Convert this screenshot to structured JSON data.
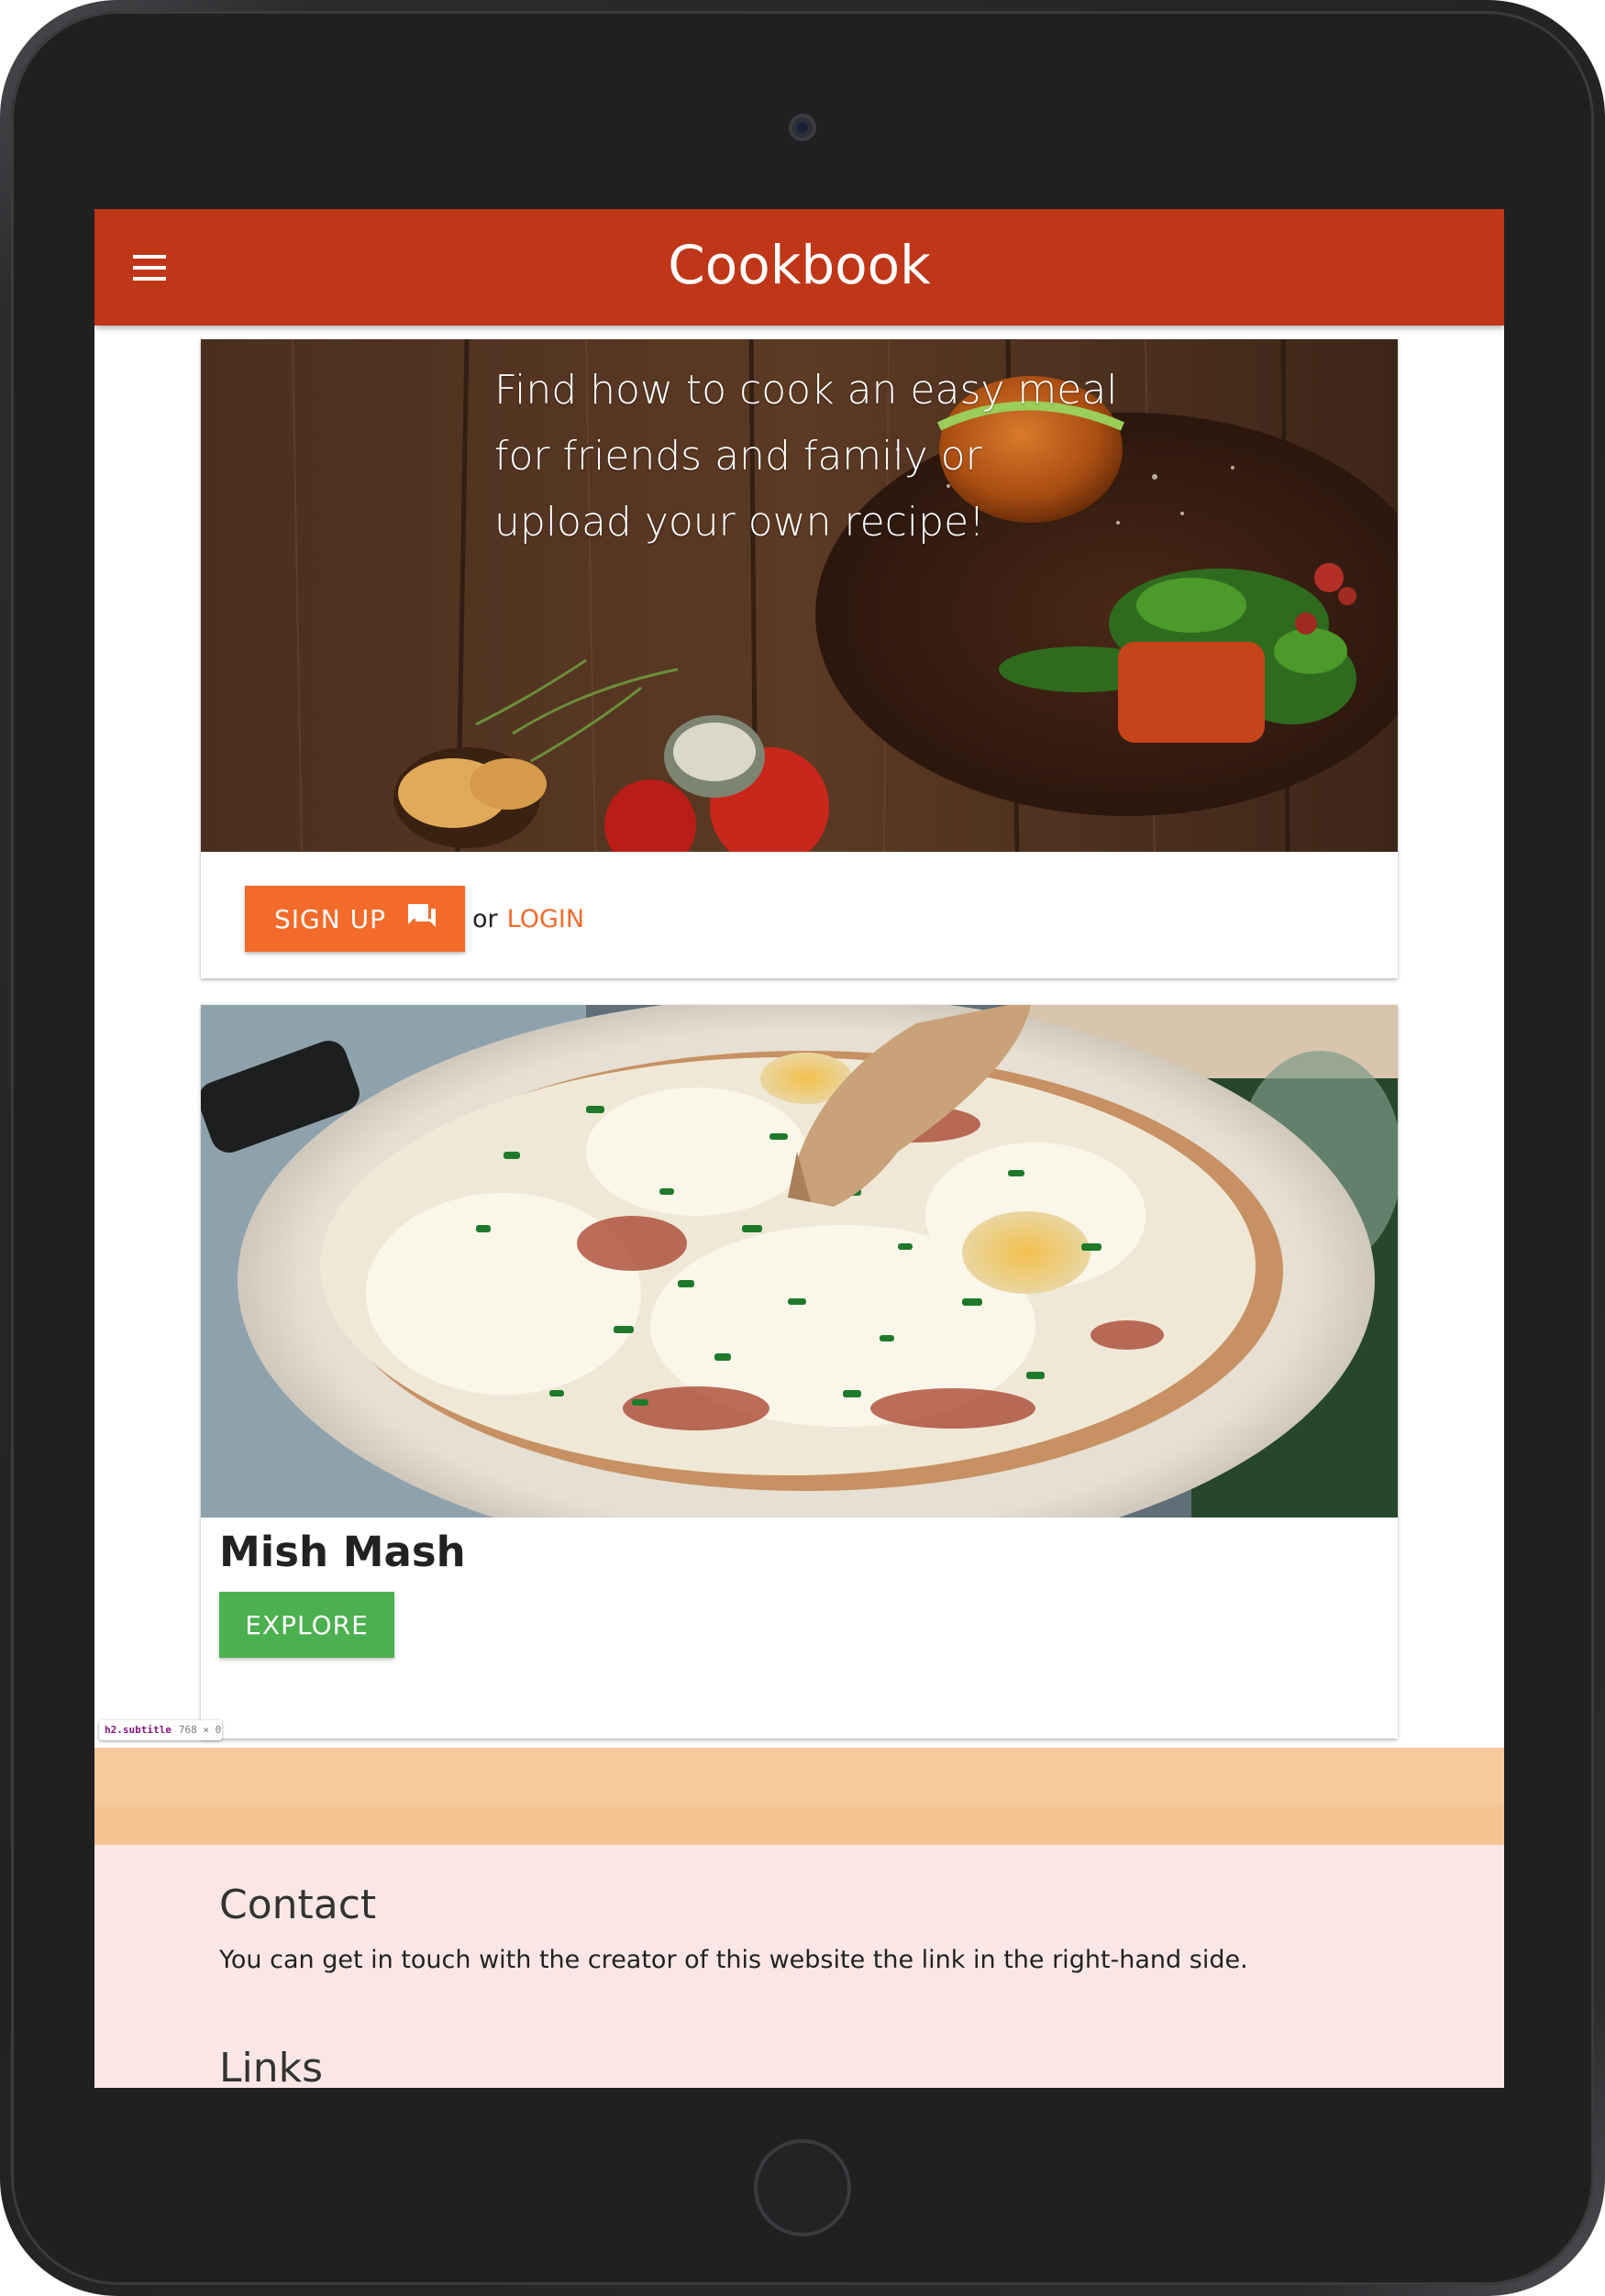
{
  "app_bar": {
    "title": "Cookbook"
  },
  "hero": {
    "lines": [
      "Find how to cook an easy meal",
      "for friends and family or",
      "upload your own recipe!"
    ],
    "signup_label": "SIGN UP",
    "or_text": "or",
    "login_label": "LOGIN"
  },
  "recipe": {
    "title": "Mish Mash",
    "explore_label": "EXPLORE"
  },
  "devtools": {
    "tag": "h2.subtitle",
    "size": "768 × 0"
  },
  "footer": {
    "contact_heading": "Contact",
    "contact_text": "You can get in touch with the creator of this website the link in the right-hand side.",
    "links_heading": "Links"
  },
  "colors": {
    "app_bar": "#bf3618",
    "accent_orange": "#f26b2a",
    "explore_green": "#4caf50",
    "subtitle_band": "#f8c99b",
    "footer_bg": "#fae7e5"
  },
  "icons": {
    "menu": "menu-icon",
    "signup": "forum-icon"
  }
}
